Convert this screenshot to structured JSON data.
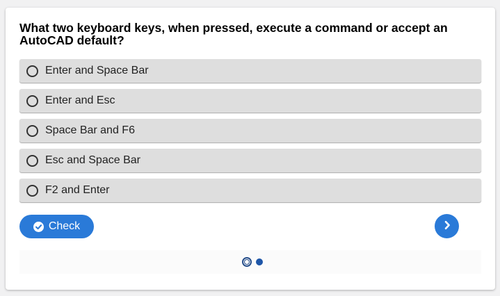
{
  "question": {
    "text": "What two keyboard keys, when pressed, execute a command or accept an AutoCAD default?"
  },
  "options": [
    {
      "label": "Enter and Space Bar",
      "selected": false
    },
    {
      "label": "Enter and Esc",
      "selected": false
    },
    {
      "label": "Space Bar and F6",
      "selected": false
    },
    {
      "label": "Esc and Space Bar",
      "selected": false
    },
    {
      "label": "F2 and Enter",
      "selected": false
    }
  ],
  "check_button": {
    "label": "Check",
    "icon": "check-circle-icon"
  },
  "next_button": {
    "icon": "chevron-right-icon"
  },
  "pagination": {
    "total": 2,
    "current": 1
  },
  "colors": {
    "accent": "#2a7ad8",
    "option_bg": "#dedede",
    "pager_dot": "#1e56a8"
  }
}
